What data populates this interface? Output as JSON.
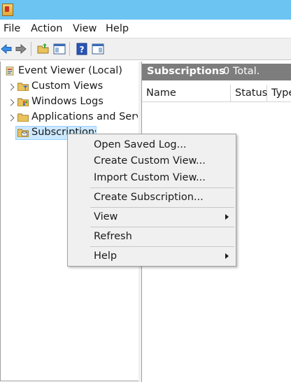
{
  "menubar": {
    "items": [
      "File",
      "Action",
      "View",
      "Help"
    ]
  },
  "tree": {
    "root": "Event Viewer (Local)",
    "items": [
      "Custom Views",
      "Windows Logs",
      "Applications and Services Logs",
      "Subscriptions"
    ]
  },
  "right_pane": {
    "title": "Subscriptions",
    "total": "0 Total.",
    "columns": [
      "Name",
      "Status",
      "Type"
    ]
  },
  "context_menu": {
    "items": [
      "Open Saved Log...",
      "Create Custom View...",
      "Import Custom View...",
      "Create Subscription...",
      "View",
      "Refresh",
      "Help"
    ]
  },
  "colors": {
    "titlebar": "#6cc4f2",
    "header_bar": "#7d7d7d",
    "selection": "#cce8ff"
  }
}
